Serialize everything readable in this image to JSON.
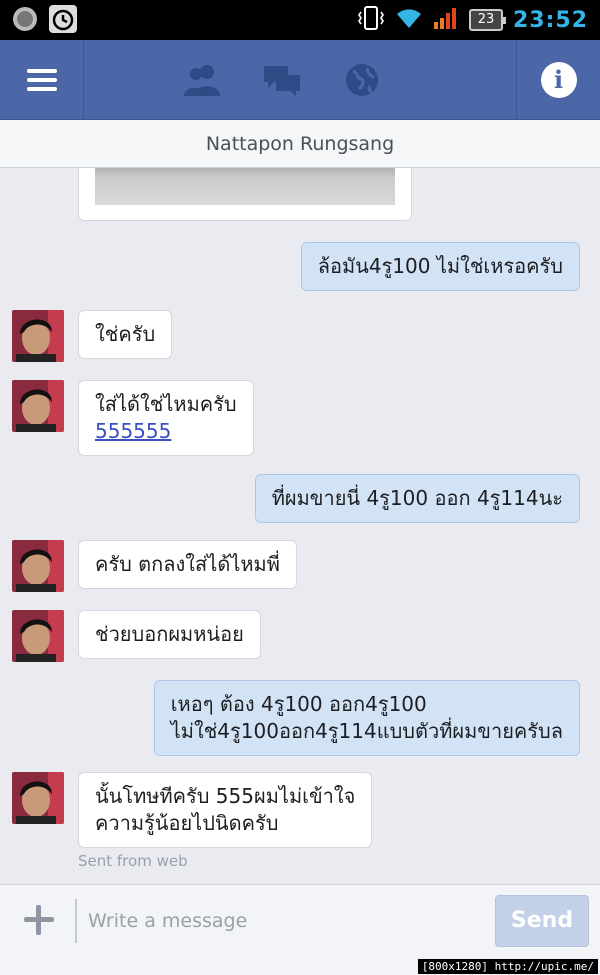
{
  "status_bar": {
    "time": "23:52",
    "battery": "23"
  },
  "header": {
    "conversation_title": "Nattapon Rungsang"
  },
  "messages": [
    {
      "side": "out",
      "lines": [
        "ล้อมัน4รู100 ไม่ใช่เหรอครับ"
      ]
    },
    {
      "side": "in",
      "lines": [
        "ใช่ครับ"
      ]
    },
    {
      "side": "in",
      "lines": [
        "ใส่ได้ใช่ไหมครับ"
      ],
      "link": "555555"
    },
    {
      "side": "out",
      "lines": [
        "ที่ผมขายนี่ 4รู100 ออก 4รู114นะ"
      ]
    },
    {
      "side": "in",
      "lines": [
        "ครับ ตกลงใส่ได้ไหมพี่"
      ]
    },
    {
      "side": "in",
      "lines": [
        "ช่วยบอกผมหน่อย"
      ]
    },
    {
      "side": "out",
      "lines": [
        "เหอๆ ต้อง 4รู100 ออก4รู100",
        "ไม่ใช่4รู100ออก4รู114แบบตัวที่ผมขายครับล"
      ]
    },
    {
      "side": "in",
      "lines": [
        "นั้นโทษทีครับ 555ผมไม่เข้าใจ",
        "ความรู้น้อยไปนิดครับ"
      ]
    }
  ],
  "sent_from": "Sent from web",
  "composer": {
    "placeholder": "Write a message",
    "send_label": "Send"
  },
  "watermark": "[800x1280] http://upic.me/",
  "colors": {
    "nav_bar": "#4b67a8",
    "outgoing_bubble": "#d3e3f6",
    "incoming_bubble": "#ffffff",
    "status_time": "#33b5e5"
  },
  "icons": [
    "menu-icon",
    "friend-requests-icon",
    "messages-icon",
    "notifications-globe-icon",
    "info-icon",
    "add-attachment-icon"
  ]
}
